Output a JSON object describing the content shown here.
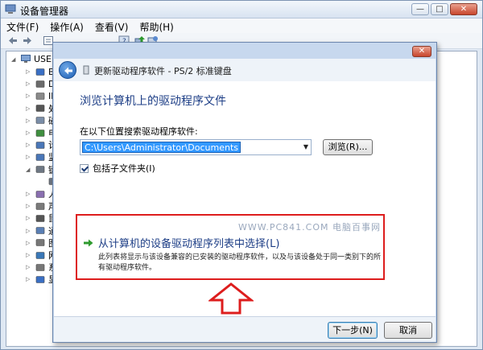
{
  "window": {
    "title": "设备管理器",
    "minimize": "—",
    "maximize": "□",
    "close": "✕"
  },
  "menu": [
    "文件(F)",
    "操作(A)",
    "查看(V)",
    "帮助(H)"
  ],
  "tree": {
    "root": "USER",
    "nodes": [
      {
        "label": "Bl",
        "icon": "bluetooth-icon"
      },
      {
        "label": "DV",
        "icon": "dvd-drive-icon"
      },
      {
        "label": "ID",
        "icon": "ide-controller-icon"
      },
      {
        "label": "处",
        "icon": "processor-icon"
      },
      {
        "label": "磁",
        "icon": "disk-drive-icon"
      },
      {
        "label": "电",
        "icon": "battery-icon"
      },
      {
        "label": "计",
        "icon": "computer-icon"
      },
      {
        "label": "监",
        "icon": "monitor-icon"
      },
      {
        "label": "键",
        "icon": "keyboard-icon"
      },
      {
        "label": "",
        "icon": "keyboard-device-icon"
      },
      {
        "label": "人",
        "icon": "hid-icon"
      },
      {
        "label": "声",
        "icon": "sound-icon"
      },
      {
        "label": "鼠",
        "icon": "mouse-icon"
      },
      {
        "label": "通",
        "icon": "usb-controller-icon"
      },
      {
        "label": "图",
        "icon": "imaging-icon"
      },
      {
        "label": "网",
        "icon": "network-adapter-icon"
      },
      {
        "label": "系",
        "icon": "system-device-icon"
      },
      {
        "label": "显",
        "icon": "display-adapter-icon"
      }
    ]
  },
  "wizard": {
    "title": "更新驱动程序软件 - PS/2 标准键盘",
    "close": "✕",
    "heading": "浏览计算机上的驱动程序文件",
    "search_label": "在以下位置搜索驱动程序软件:",
    "path_value": "C:\\Users\\Administrator\\Documents",
    "browse_label": "浏览(R)...",
    "include_subfolders": "包括子文件夹(I)",
    "include_checked": true,
    "watermark": "WWW.PC841.COM 电脑百事网",
    "pick_title": "从计算机的设备驱动程序列表中选择(L)",
    "pick_desc": "此列表将显示与该设备兼容的已安装的驱动程序软件，以及与该设备处于同一类别下的所有驱动程序软件。",
    "next_label": "下一步(N)",
    "cancel_label": "取消"
  },
  "colors": {
    "accent": "#1d3e86",
    "highlight": "#dd1d1d",
    "selection": "#3399ff",
    "green_arrow": "#2e9a2e"
  }
}
